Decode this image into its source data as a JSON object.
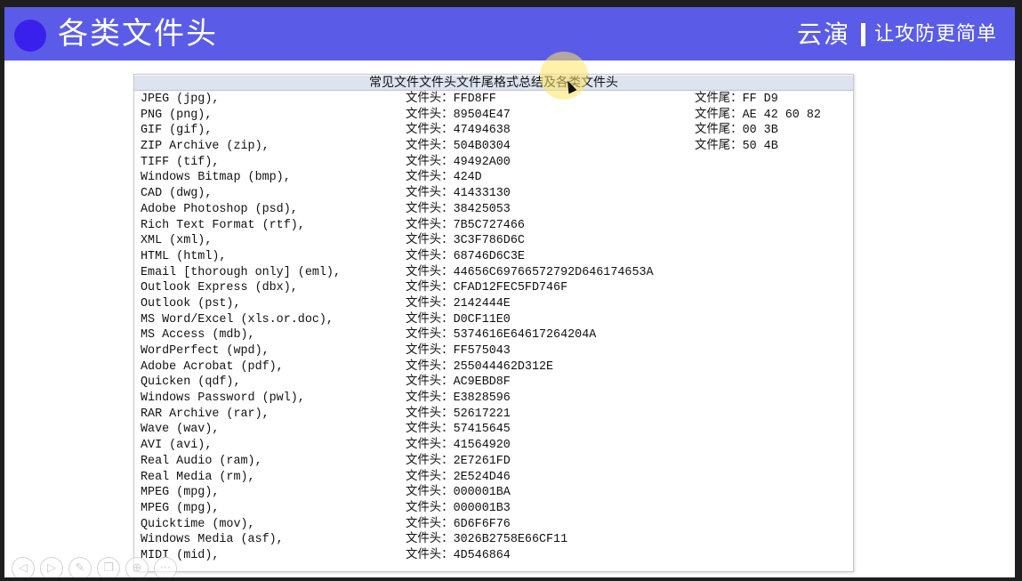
{
  "header": {
    "title": "各类文件头",
    "brand_name": "云演",
    "brand_slogan": "让攻防更简单"
  },
  "document": {
    "title": "常见文件文件头文件尾格式总结及各类文件头",
    "head_label": "文件头：",
    "tail_label": "文件尾：",
    "rows": [
      {
        "name": "JPEG (jpg),",
        "head": "FFD8FF",
        "tail": "FF D9"
      },
      {
        "name": "PNG (png),",
        "head": "89504E47",
        "tail": "AE 42 60 82"
      },
      {
        "name": "GIF (gif),",
        "head": "47494638",
        "tail": "00 3B"
      },
      {
        "name": "ZIP Archive (zip),",
        "head": "504B0304",
        "tail": "50 4B"
      },
      {
        "name": "TIFF (tif),",
        "head": "49492A00",
        "tail": ""
      },
      {
        "name": "Windows Bitmap (bmp),",
        "head": "424D",
        "tail": ""
      },
      {
        "name": "CAD (dwg),",
        "head": "41433130",
        "tail": ""
      },
      {
        "name": "Adobe Photoshop (psd),",
        "head": "38425053",
        "tail": ""
      },
      {
        "name": "Rich Text Format (rtf),",
        "head": "7B5C727466",
        "tail": ""
      },
      {
        "name": "XML (xml),",
        "head": "3C3F786D6C",
        "tail": ""
      },
      {
        "name": "HTML (html),",
        "head": "68746D6C3E",
        "tail": ""
      },
      {
        "name": "Email [thorough only] (eml),",
        "head": "44656C69766572792D646174653A",
        "tail": ""
      },
      {
        "name": "Outlook Express (dbx),",
        "head": "CFAD12FEC5FD746F",
        "tail": ""
      },
      {
        "name": "Outlook (pst),",
        "head": "2142444E",
        "tail": ""
      },
      {
        "name": "MS Word/Excel (xls.or.doc),",
        "head": "D0CF11E0",
        "tail": ""
      },
      {
        "name": "MS Access (mdb),",
        "head": "5374616E64617264204A",
        "tail": ""
      },
      {
        "name": "WordPerfect (wpd),",
        "head": "FF575043",
        "tail": ""
      },
      {
        "name": "Adobe Acrobat (pdf),",
        "head": "255044462D312E",
        "tail": ""
      },
      {
        "name": "Quicken (qdf),",
        "head": "AC9EBD8F",
        "tail": ""
      },
      {
        "name": "Windows Password (pwl),",
        "head": "E3828596",
        "tail": ""
      },
      {
        "name": "RAR Archive (rar),",
        "head": "52617221",
        "tail": ""
      },
      {
        "name": "Wave (wav),",
        "head": "57415645",
        "tail": ""
      },
      {
        "name": "AVI (avi),",
        "head": "41564920",
        "tail": ""
      },
      {
        "name": "Real Audio (ram),",
        "head": "2E7261FD",
        "tail": ""
      },
      {
        "name": "Real Media (rm),",
        "head": "2E524D46",
        "tail": ""
      },
      {
        "name": "MPEG (mpg),",
        "head": "000001BA",
        "tail": ""
      },
      {
        "name": "MPEG (mpg),",
        "head": "000001B3",
        "tail": ""
      },
      {
        "name": "Quicktime (mov),",
        "head": "6D6F6F76",
        "tail": ""
      },
      {
        "name": "Windows Media (asf),",
        "head": "3026B2758E66CF11",
        "tail": ""
      },
      {
        "name": "MIDI (mid),",
        "head": "4D546864",
        "tail": ""
      }
    ]
  },
  "controls": [
    {
      "name": "prev-icon",
      "glyph": "◁"
    },
    {
      "name": "next-icon",
      "glyph": "▷"
    },
    {
      "name": "pen-icon",
      "glyph": "✎"
    },
    {
      "name": "slides-icon",
      "glyph": "❐"
    },
    {
      "name": "zoom-icon",
      "glyph": "⊕"
    },
    {
      "name": "more-icon",
      "glyph": "⋯"
    }
  ],
  "colors": {
    "header_bg": "#5a5ce8",
    "header_circle": "#3a20ec",
    "doc_title_bg": "#dde3ef"
  }
}
